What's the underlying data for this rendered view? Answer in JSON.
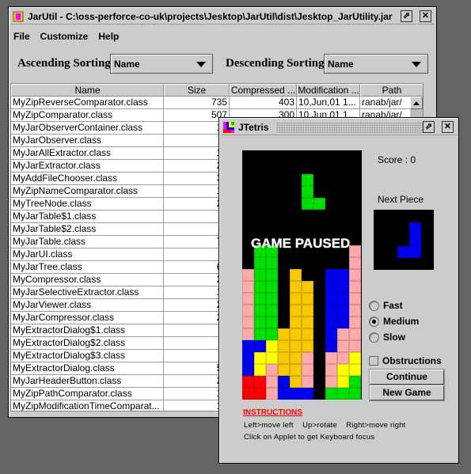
{
  "main_window": {
    "title": "JarUtil - C:\\oss-perforce-co-uk\\projects\\Jesktop\\JarUtil\\dist\\Jesktop_JarUtility.jar",
    "menu": [
      "File",
      "Customize",
      "Help"
    ],
    "ascending_label": "Ascending Sorting",
    "ascending_value": "Name",
    "descending_label": "Descending Sorting",
    "descending_value": "Name",
    "table": {
      "columns": [
        "Name",
        "Size",
        "Compressed ...",
        "Modification ...",
        "Path"
      ],
      "rows": [
        [
          "MyZipReverseComparator.class",
          "735",
          "403",
          "10,Jun,01 1...",
          "ranab/jar/"
        ],
        [
          "MyZipComparator.class",
          "507",
          "300",
          "10,Jun,01 1...",
          "ranab/jar/"
        ],
        [
          "MyJarObserverContainer.class",
          "16",
          "",
          "",
          ""
        ],
        [
          "MyJarObserver.class",
          "2",
          "",
          "",
          ""
        ],
        [
          "MyJarAllExtractor.class",
          "18",
          "",
          "",
          ""
        ],
        [
          "MyJarExtractor.class",
          "28",
          "",
          "",
          ""
        ],
        [
          "MyAddFileChooser.class",
          "30",
          "",
          "",
          ""
        ],
        [
          "MyZipNameComparator.class",
          "15",
          "",
          "",
          ""
        ],
        [
          "MyTreeNode.class",
          "26",
          "",
          "",
          ""
        ],
        [
          "MyJarTable$1.class",
          "9",
          "",
          "",
          ""
        ],
        [
          "MyJarTable$2.class",
          "9",
          "",
          "",
          ""
        ],
        [
          "MyJarTable.class",
          "75",
          "",
          "",
          ""
        ],
        [
          "MyJarUI.class",
          "2",
          "",
          "",
          ""
        ],
        [
          "MyJarTree.class",
          "63",
          "",
          "",
          ""
        ],
        [
          "MyCompressor.class",
          "23",
          "",
          "",
          ""
        ],
        [
          "MyJarSelectiveExtractor.class",
          "18",
          "",
          "",
          ""
        ],
        [
          "MyJarViewer.class",
          "20",
          "",
          "",
          ""
        ],
        [
          "MyJarCompressor.class",
          "22",
          "",
          "",
          ""
        ],
        [
          "MyExtractorDialog$1.class",
          "7",
          "",
          "",
          ""
        ],
        [
          "MyExtractorDialog$2.class",
          "7",
          "",
          "",
          ""
        ],
        [
          "MyExtractorDialog$3.class",
          "7",
          "",
          "",
          ""
        ],
        [
          "MyExtractorDialog.class",
          "52",
          "",
          "",
          ""
        ],
        [
          "MyJarHeaderButton.class",
          "23",
          "",
          "",
          ""
        ],
        [
          "MyZipPathComparator.class",
          "14",
          "",
          "",
          ""
        ],
        [
          "MyZipModificationTimeComparat...",
          "12",
          "",
          "",
          ""
        ]
      ]
    }
  },
  "tetris": {
    "title": "JTetris",
    "score_label": "Score : 0",
    "next_label": "Next Piece",
    "paused_text": "GAME PAUSED",
    "speeds": [
      {
        "label": "Fast",
        "selected": false
      },
      {
        "label": "Medium",
        "selected": true
      },
      {
        "label": "Slow",
        "selected": false
      }
    ],
    "obstructions_label": "Obstructions",
    "obstructions_checked": false,
    "continue_label": "Continue",
    "new_game_label": "New Game",
    "instructions_title": "INSTRUCTIONS",
    "instructions_line1": "Left>move left    Up>rotate    Right>move right",
    "instructions_line2": "Click on Applet to get Keyboard focus",
    "colors": {
      "G": "#00e000",
      "B": "#0000f0",
      "Y": "#ffff00",
      "O": "#f8c800",
      "P": "#ffaaaa",
      "R": "#ff0000"
    },
    "board": [
      "..........",
      "..........",
      ".....G....",
      ".....G....",
      ".....GG...",
      "..........",
      "..........",
      "..........",
      ".GG......P",
      ".GG......P",
      "PGG.O..BBP",
      "PGG.OO.BBP",
      "PGG.OO.BBP",
      "PGG.OO.BBP",
      "PGG.OO.BBP",
      "PGGOOO.BPP",
      "BBYOOO.BPP",
      "BYYOOP.PPY",
      "BYPOOP.PYY",
      "RRPBOP.PYG",
      "RRPBBB.GGG"
    ],
    "next_piece": [
      "..B",
      "..B",
      ".BB"
    ]
  }
}
